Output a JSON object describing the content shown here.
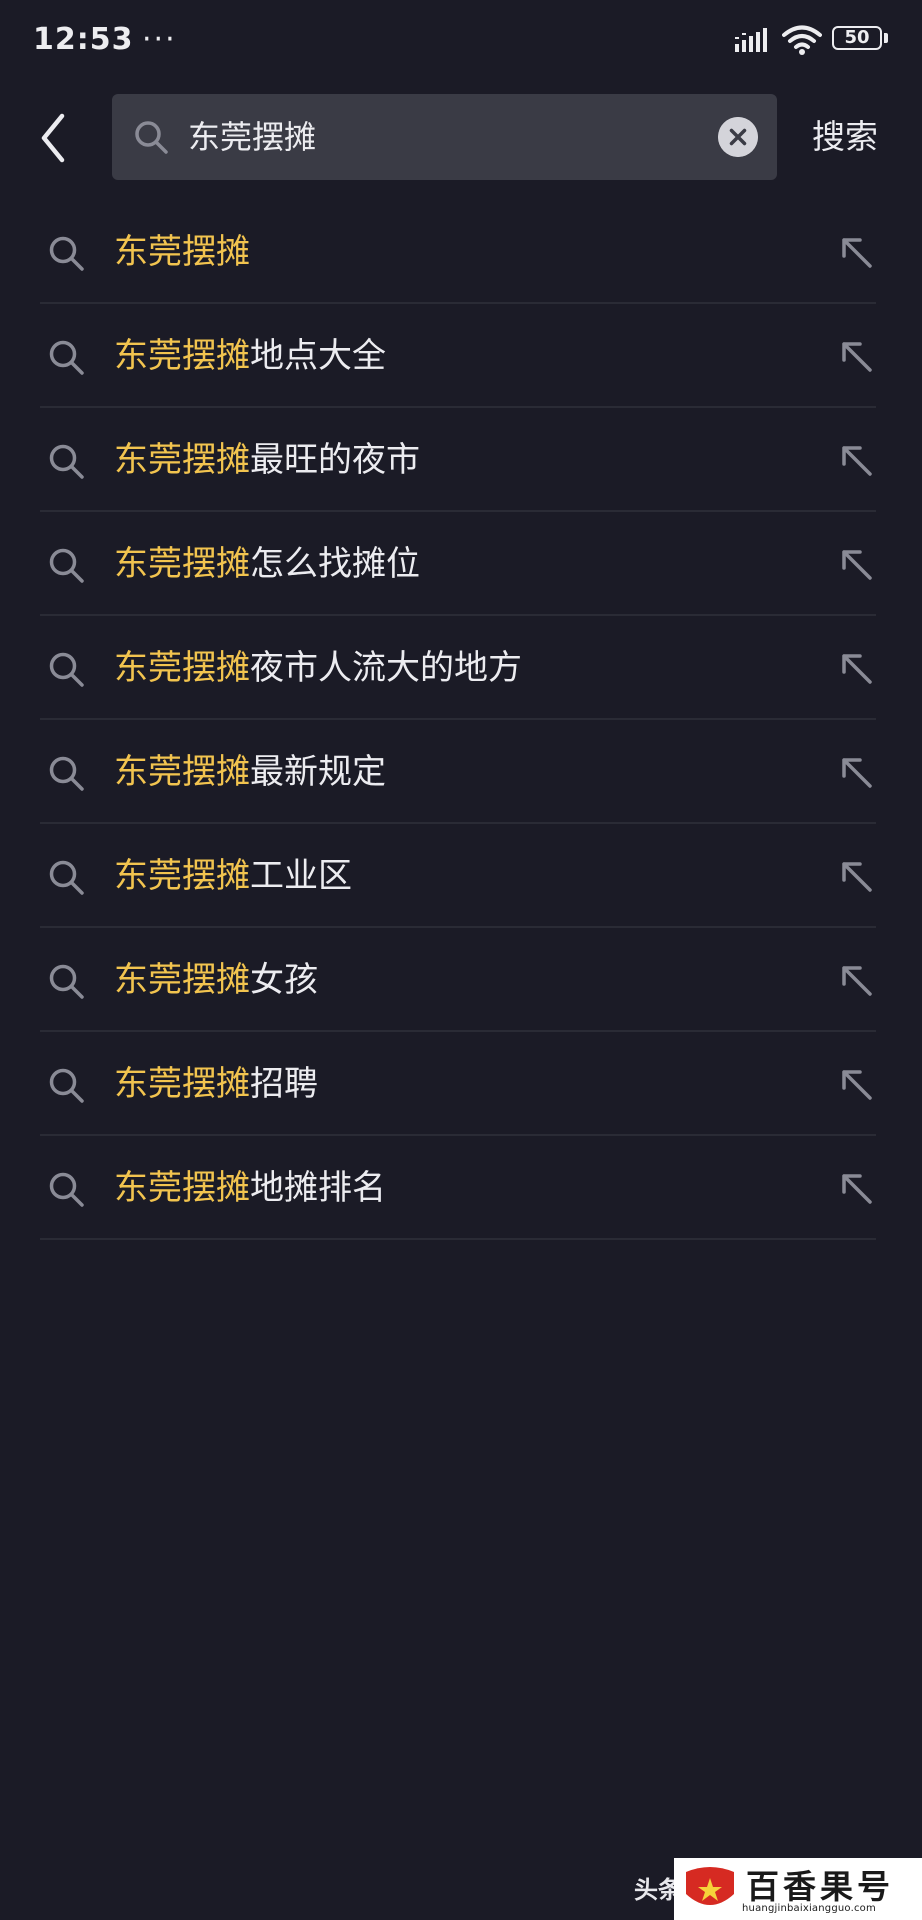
{
  "status_bar": {
    "time": "12:53",
    "notification_dots": "···",
    "battery_level": "50",
    "icons": [
      "signal-icon",
      "wifi-icon",
      "battery-icon"
    ]
  },
  "header": {
    "back_icon": "chevron-left-icon",
    "search": {
      "icon": "search-icon",
      "value": "东莞摆摊",
      "clear_icon": "clear-icon"
    },
    "submit_label": "搜索"
  },
  "suggestions": [
    {
      "highlight": "东莞摆摊",
      "rest": ""
    },
    {
      "highlight": "东莞摆摊",
      "rest": "地点大全"
    },
    {
      "highlight": "东莞摆摊",
      "rest": "最旺的夜市"
    },
    {
      "highlight": "东莞摆摊",
      "rest": "怎么找摊位"
    },
    {
      "highlight": "东莞摆摊",
      "rest": "夜市人流大的地方"
    },
    {
      "highlight": "东莞摆摊",
      "rest": "最新规定"
    },
    {
      "highlight": "东莞摆摊",
      "rest": "工业区"
    },
    {
      "highlight": "东莞摆摊",
      "rest": "女孩"
    },
    {
      "highlight": "东莞摆摊",
      "rest": "招聘"
    },
    {
      "highlight": "东莞摆摊",
      "rest": "地摊排名"
    }
  ],
  "colors": {
    "background": "#1b1b26",
    "search_box": "#3a3b45",
    "highlight": "#f2c44f",
    "text": "#ececf0",
    "icon_gray": "#8a8b96"
  },
  "watermark": {
    "prefix": "头条",
    "brand": "百香果号",
    "url": "huangjinbaixiangguo.com"
  }
}
